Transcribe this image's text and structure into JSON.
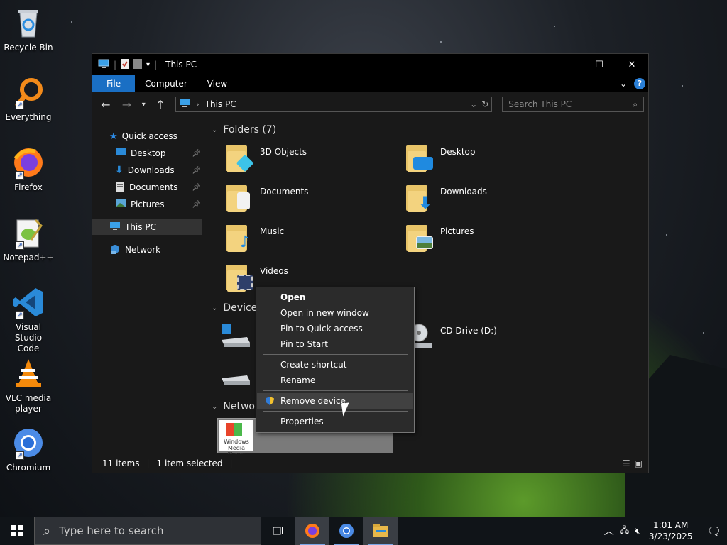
{
  "desktop": {
    "icons": [
      {
        "label": "Recycle Bin",
        "icon": "recycle-bin-icon"
      },
      {
        "label": "Everything",
        "icon": "everything-icon"
      },
      {
        "label": "Firefox",
        "icon": "firefox-icon"
      },
      {
        "label": "Notepad++",
        "icon": "notepad-plus-plus-icon"
      },
      {
        "label": "Visual Studio Code",
        "icon": "vscode-icon"
      },
      {
        "label": "VLC media player",
        "icon": "vlc-icon"
      },
      {
        "label": "Chromium",
        "icon": "chromium-icon"
      }
    ]
  },
  "window": {
    "title": "This PC",
    "ribbon_tabs": [
      "File",
      "Computer",
      "View"
    ],
    "address": {
      "location": "This PC"
    },
    "search": {
      "placeholder": "Search This PC"
    },
    "nav": {
      "quick_access": "Quick access",
      "items": [
        "Desktop",
        "Downloads",
        "Documents",
        "Pictures"
      ],
      "this_pc": "This PC",
      "network": "Network"
    },
    "groups": {
      "folders": "Folders (7)",
      "devices": "Devices",
      "network": "Network"
    },
    "folders": [
      {
        "label": "3D Objects",
        "icon": "3d-objects-folder-icon"
      },
      {
        "label": "Desktop",
        "icon": "desktop-folder-icon"
      },
      {
        "label": "Documents",
        "icon": "documents-folder-icon"
      },
      {
        "label": "Downloads",
        "icon": "downloads-folder-icon"
      },
      {
        "label": "Music",
        "icon": "music-folder-icon"
      },
      {
        "label": "Pictures",
        "icon": "pictures-folder-icon"
      },
      {
        "label": "Videos",
        "icon": "videos-folder-icon"
      }
    ],
    "devices": [
      {
        "label": "CD Drive (D:)",
        "icon": "cd-drive-icon"
      }
    ],
    "network_item": {
      "tile_text": "Windows Media Player"
    },
    "status": {
      "items": "11 items",
      "selected": "1 item selected"
    }
  },
  "context_menu": {
    "items": [
      "Open",
      "Open in new window",
      "Pin to Quick access",
      "Pin to Start",
      "Create shortcut",
      "Rename",
      "Remove device",
      "Properties"
    ],
    "hovered": "Remove device"
  },
  "taskbar": {
    "search_placeholder": "Type here to search",
    "time": "1:01 AM",
    "date": "3/23/2025"
  },
  "colors": {
    "accent": "#1a6fc4",
    "window_bg": "#191919",
    "menu_bg": "#2b2b2b"
  }
}
